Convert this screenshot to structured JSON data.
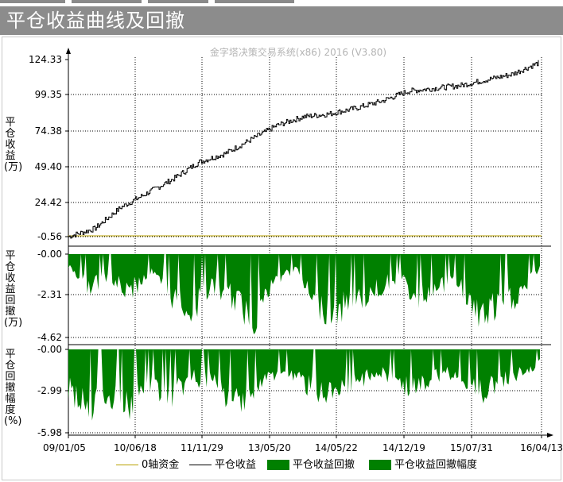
{
  "window": {
    "title": "平仓收益曲线及回撤",
    "watermark": "金字塔决策交易系统(x86) 2016 (V3.80)"
  },
  "colors": {
    "title_bg": "#8c8c8c",
    "equity_line": "#000000",
    "zero_line": "#b8a000",
    "drawdown_fill": "#008000"
  },
  "chart_data": [
    {
      "type": "line",
      "ylabel": "平仓收益(万)",
      "yticks": [
        "124.33",
        "99.35",
        "74.38",
        "49.40",
        "24.42",
        "-0.56"
      ],
      "ylim": [
        -0.56,
        124.33
      ],
      "series": [
        {
          "name": "平仓收益",
          "x": [
            "2009-01-05",
            "2009-07-01",
            "2010-01-01",
            "2010-06-18",
            "2011-01-01",
            "2011-06-01",
            "2011-11-29",
            "2012-06-01",
            "2012-12-01",
            "2013-05-20",
            "2013-10-01",
            "2014-05-22",
            "2014-10-01",
            "2014-12-19",
            "2015-03-01",
            "2015-07-31",
            "2015-10-01",
            "2016-02-01",
            "2016-04-13"
          ],
          "values": [
            -0.56,
            5.0,
            20.0,
            30.0,
            40.0,
            52.0,
            58.0,
            68.0,
            78.0,
            84.0,
            86.0,
            90.0,
            95.0,
            102.0,
            104.0,
            106.0,
            110.0,
            114.0,
            122.0
          ]
        },
        {
          "name": "0轴资金",
          "values": [
            0,
            0
          ]
        }
      ]
    },
    {
      "type": "area",
      "ylabel": "平仓收益回撤(万)",
      "yticks": [
        "-0.00",
        "-2.31",
        "-4.62"
      ],
      "ylim": [
        -4.62,
        0
      ],
      "series": [
        {
          "name": "平仓收益回撤",
          "values": [
            -0.8,
            -2.2,
            -1.8,
            -2.6,
            -1.2,
            -2.9,
            -3.8,
            -2.2,
            -3.0,
            -4.5,
            -2.0,
            -1.0,
            -3.4,
            -4.0,
            -3.3,
            -2.5,
            -1.6,
            -3.0,
            -2.4,
            -1.9,
            -4.3,
            -3.7,
            -2.8,
            -1.0
          ]
        }
      ]
    },
    {
      "type": "area",
      "ylabel": "平仓回撤幅度(%)",
      "yticks": [
        "-0.00",
        "-2.99",
        "-5.98"
      ],
      "ylim": [
        -5.98,
        0
      ],
      "series": [
        {
          "name": "平仓收益回撤幅度",
          "values": [
            -3.5,
            -5.6,
            -4.0,
            -5.0,
            -3.0,
            -4.4,
            -2.5,
            -3.0,
            -4.7,
            -3.8,
            -2.2,
            -2.4,
            -3.6,
            -4.4,
            -3.0,
            -2.0,
            -2.9,
            -3.6,
            -2.4,
            -2.0,
            -4.0,
            -2.8,
            -2.2,
            -1.2
          ]
        }
      ]
    }
  ],
  "xaxis": {
    "ticks": [
      "09/01/05",
      "10/06/18",
      "11/11/29",
      "13/05/20",
      "14/05/22",
      "14/12/19",
      "15/07/31",
      "16/04/13"
    ]
  },
  "legend": {
    "items": [
      "0轴资金",
      "平仓收益",
      "平仓收益回撤",
      "平仓收益回撤幅度"
    ]
  }
}
